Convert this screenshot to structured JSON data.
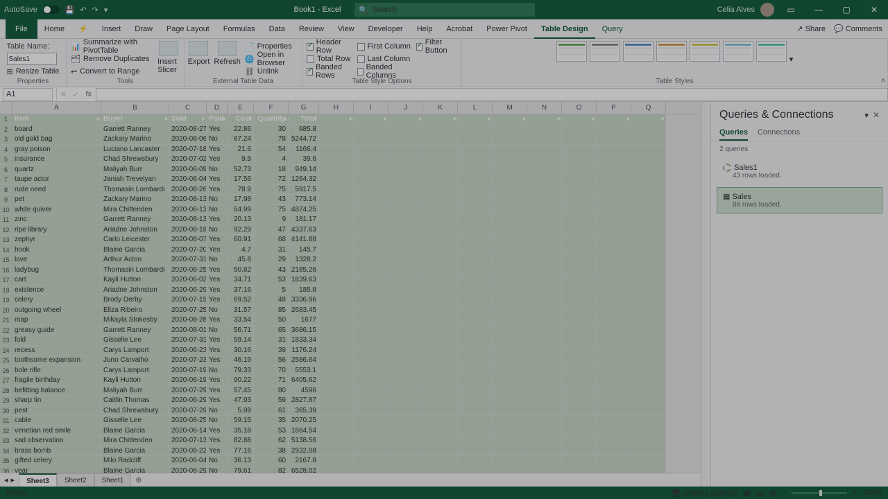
{
  "title": {
    "doc": "Book1",
    "app": "Excel",
    "autosave": "AutoSave"
  },
  "search": {
    "placeholder": "Search"
  },
  "user": {
    "name": "Celia Alves"
  },
  "winbtns": {
    "min": "—",
    "max": "▢",
    "close": "✕"
  },
  "tabs": [
    "File",
    "Home",
    "",
    "Insert",
    "Draw",
    "Page Layout",
    "Formulas",
    "Data",
    "Review",
    "View",
    "Developer",
    "Help",
    "Acrobat",
    "Power Pivot",
    "Table Design",
    "Query"
  ],
  "share": "Share",
  "comments": "Comments",
  "ribbon": {
    "props": {
      "tableNameLabel": "Table Name:",
      "tableName": "Sales1",
      "resize": "Resize Table",
      "group": "Properties"
    },
    "tools": {
      "pivot": "Summarize with PivotTable",
      "dupes": "Remove Duplicates",
      "range": "Convert to Range",
      "slicer": "Insert Slicer",
      "group": "Tools"
    },
    "ext": {
      "export": "Export",
      "refresh": "Refresh",
      "props": "Properties",
      "open": "Open in Browser",
      "unlink": "Unlink",
      "group": "External Table Data"
    },
    "styleopt": {
      "headerRow": "Header Row",
      "totalRow": "Total Row",
      "bandedRows": "Banded Rows",
      "firstCol": "First Column",
      "lastCol": "Last Column",
      "bandedCols": "Banded Columns",
      "filter": "Filter Button",
      "group": "Table Style Options"
    },
    "stylesGroup": "Table Styles"
  },
  "fbar": {
    "ref": "A1",
    "fx": "fx"
  },
  "cols": [
    "A",
    "B",
    "C",
    "D",
    "E",
    "F",
    "G",
    "H",
    "I",
    "J",
    "K",
    "L",
    "M",
    "N",
    "O",
    "P",
    "Q"
  ],
  "headers": [
    "Item",
    "Buyer",
    "Sold",
    "Paid",
    "Cost",
    "Quantity",
    "Total"
  ],
  "rows": [
    [
      "board",
      "Garrett Ranney",
      "2020-08-27",
      "Yes",
      "22.86",
      "30",
      "685.8"
    ],
    [
      "old gold bag",
      "Zackary Marino",
      "2020-08-06",
      "No",
      "67.24",
      "78",
      "5244.72"
    ],
    [
      "gray poison",
      "Luciano Lancaster",
      "2020-07-18",
      "Yes",
      "21.6",
      "54",
      "1166.4"
    ],
    [
      "insurance",
      "Chad Shrewsbury",
      "2020-07-02",
      "Yes",
      "9.9",
      "4",
      "39.6"
    ],
    [
      "quartz",
      "Maliyah Burr",
      "2020-06-09",
      "No",
      "52.73",
      "18",
      "949.14"
    ],
    [
      "taupe actor",
      "Janiah Trevelyan",
      "2020-06-04",
      "Yes",
      "17.56",
      "72",
      "1264.32"
    ],
    [
      "rude need",
      "Thomasin Lombardi",
      "2020-08-26",
      "Yes",
      "78.9",
      "75",
      "5917.5"
    ],
    [
      "pet",
      "Zackary Marino",
      "2020-08-13",
      "No",
      "17.98",
      "43",
      "773.14"
    ],
    [
      "white quiver",
      "Mira Chittenden",
      "2020-06-13",
      "No",
      "64.99",
      "75",
      "4874.25"
    ],
    [
      "zinc",
      "Garrett Ranney",
      "2020-08-13",
      "Yes",
      "20.13",
      "9",
      "181.17"
    ],
    [
      "ripe library",
      "Ariadne Johnston",
      "2020-08-18",
      "No",
      "92.29",
      "47",
      "4337.63"
    ],
    [
      "zephyr",
      "Carlo Leicester",
      "2020-08-07",
      "Yes",
      "60.91",
      "68",
      "4141.88"
    ],
    [
      "hook",
      "Blaine Garcia",
      "2020-07-20",
      "Yes",
      "4.7",
      "31",
      "145.7"
    ],
    [
      "love",
      "Arthur Acton",
      "2020-07-31",
      "No",
      "45.8",
      "29",
      "1328.2"
    ],
    [
      "ladybug",
      "Thomasin Lombardi",
      "2020-08-25",
      "Yes",
      "50.82",
      "43",
      "2185.26"
    ],
    [
      "cart",
      "Kayli Hutton",
      "2020-06-02",
      "Yes",
      "34.71",
      "53",
      "1839.63"
    ],
    [
      "existence",
      "Ariadne Johnston",
      "2020-06-29",
      "Yes",
      "37.16",
      "5",
      "185.8"
    ],
    [
      "celery",
      "Brody Derby",
      "2020-07-15",
      "Yes",
      "69.52",
      "48",
      "3336.96"
    ],
    [
      "outgoing wheel",
      "Eliza Ribeiro",
      "2020-07-25",
      "No",
      "31.57",
      "85",
      "2683.45"
    ],
    [
      "map",
      "Mikayla Stokesby",
      "2020-08-28",
      "Yes",
      "33.54",
      "50",
      "1677"
    ],
    [
      "greasy guide",
      "Garrett Ranney",
      "2020-08-01",
      "No",
      "56.71",
      "65",
      "3686.15"
    ],
    [
      "fold",
      "Gisselle Lee",
      "2020-07-31",
      "Yes",
      "59.14",
      "31",
      "1833.34"
    ],
    [
      "recess",
      "Carys Lamport",
      "2020-06-23",
      "Yes",
      "30.16",
      "39",
      "1176.24"
    ],
    [
      "toothsome expansion",
      "Juno Carvalho",
      "2020-07-23",
      "Yes",
      "46.19",
      "56",
      "2586.64"
    ],
    [
      "bole rifle",
      "Carys Lamport",
      "2020-07-19",
      "No",
      "79.33",
      "70",
      "5553.1"
    ],
    [
      "fragile birthday",
      "Kayli Hutton",
      "2020-06-19",
      "Yes",
      "90.22",
      "71",
      "6405.62"
    ],
    [
      "befitting balance",
      "Maliyah Burr",
      "2020-07-29",
      "Yes",
      "57.45",
      "80",
      "4596"
    ],
    [
      "sharp tin",
      "Caitlin Thomas",
      "2020-06-29",
      "Yes",
      "47.93",
      "59",
      "2827.87"
    ],
    [
      "pest",
      "Chad Shrewsbury",
      "2020-07-29",
      "No",
      "5.99",
      "61",
      "365.39"
    ],
    [
      "cable",
      "Gisselle Lee",
      "2020-08-25",
      "No",
      "59.15",
      "35",
      "2070.25"
    ],
    [
      "venetian red smile",
      "Blaine Garcia",
      "2020-06-14",
      "Yes",
      "35.18",
      "53",
      "1864.54"
    ],
    [
      "sad observation",
      "Mira Chittenden",
      "2020-07-13",
      "Yes",
      "82.88",
      "62",
      "5138.56"
    ],
    [
      "brass bomb",
      "Blaine Garcia",
      "2020-08-22",
      "Yes",
      "77.16",
      "38",
      "2932.08"
    ],
    [
      "gifted celery",
      "Milo Radcliff",
      "2020-06-04",
      "No",
      "36.13",
      "60",
      "2167.8"
    ],
    [
      "year",
      "Blaine Garcia",
      "2020-06-29",
      "No",
      "79.61",
      "82",
      "6528.02"
    ]
  ],
  "pane": {
    "title": "Queries & Connections",
    "tabs": [
      "Queries",
      "Connections"
    ],
    "count": "2 queries",
    "queries": [
      {
        "name": "Sales1",
        "status": "43 rows loaded."
      },
      {
        "name": "Sales",
        "status": "86 rows loaded."
      }
    ]
  },
  "sheets": [
    "Sheet3",
    "Sheet2",
    "Sheet1"
  ],
  "status": {
    "ready": "Ready",
    "display": "Display Settings",
    "zoom": "100%"
  }
}
